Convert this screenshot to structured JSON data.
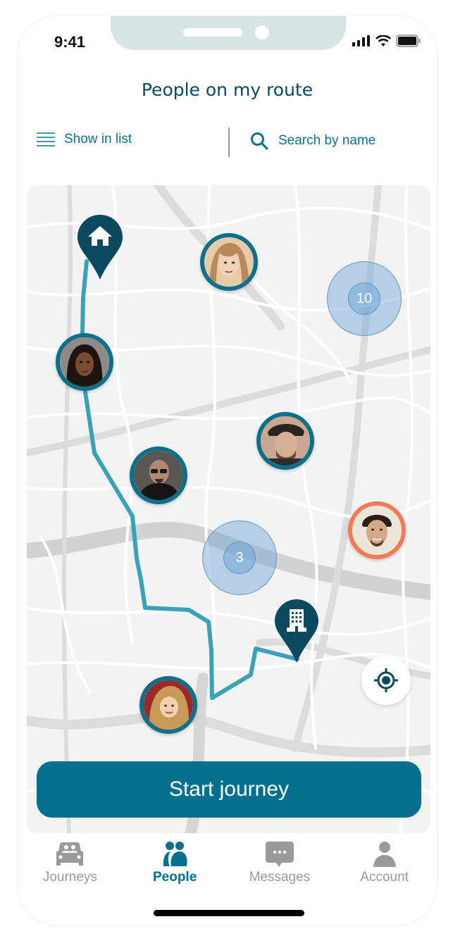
{
  "status_bar": {
    "time": "9:41"
  },
  "header": {
    "title": "People on my route"
  },
  "toolbar": {
    "list_label": "Show in list",
    "search_placeholder": "Search by name"
  },
  "map": {
    "route_color": "#3aa2b8",
    "pin_color": "#0b4a5e",
    "pins": [
      {
        "name": "home-pin",
        "icon": "home-icon"
      },
      {
        "name": "work-pin",
        "icon": "office-building-icon"
      }
    ],
    "clusters": [
      {
        "count": "10"
      },
      {
        "count": "3"
      }
    ],
    "people": [
      {
        "name": "person-1",
        "highlighted": false
      },
      {
        "name": "person-2",
        "highlighted": false
      },
      {
        "name": "person-3",
        "highlighted": false
      },
      {
        "name": "person-4",
        "highlighted": false
      },
      {
        "name": "person-5",
        "highlighted": true
      },
      {
        "name": "person-6",
        "highlighted": false
      }
    ]
  },
  "actions": {
    "start_label": "Start journey"
  },
  "tabbar": {
    "items": [
      {
        "label": "Journeys",
        "icon": "car-icon",
        "active": false
      },
      {
        "label": "People",
        "icon": "people-icon",
        "active": true
      },
      {
        "label": "Messages",
        "icon": "chat-bubble-icon",
        "active": false
      },
      {
        "label": "Account",
        "icon": "user-icon",
        "active": false
      }
    ]
  },
  "colors": {
    "accent": "#04708d",
    "title": "#0b4a5e",
    "highlight_ring": "#f47a55",
    "inactive": "#9a9a9a"
  }
}
